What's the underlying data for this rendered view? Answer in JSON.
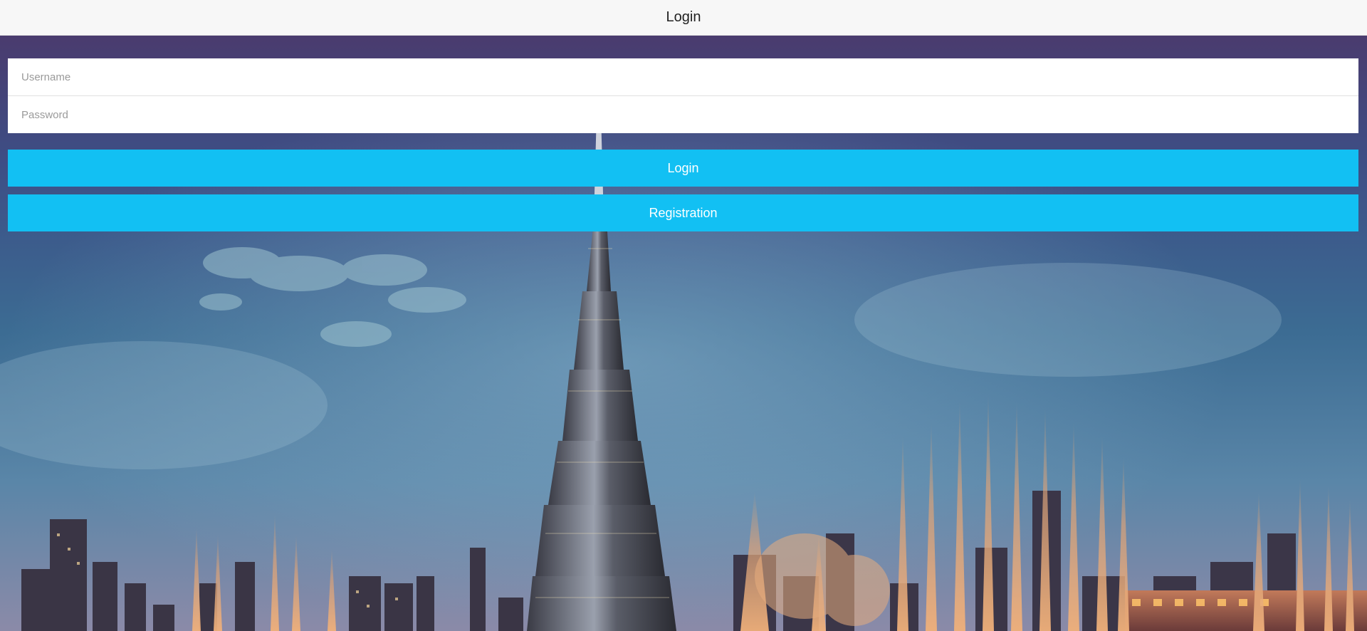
{
  "header": {
    "title": "Login"
  },
  "form": {
    "username_placeholder": "Username",
    "username_value": "",
    "password_placeholder": "Password",
    "password_value": ""
  },
  "actions": {
    "login_label": "Login",
    "register_label": "Registration"
  },
  "colors": {
    "button": "#12c0f3",
    "header_bg": "#f7f7f7"
  }
}
